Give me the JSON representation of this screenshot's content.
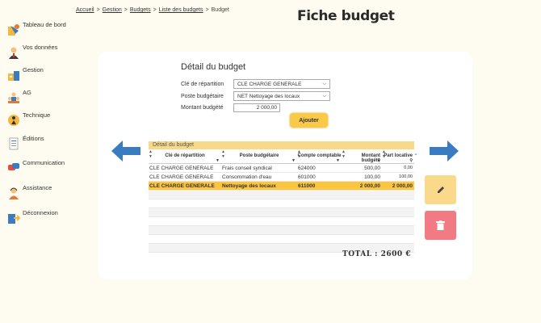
{
  "sidebar": {
    "items": [
      {
        "label": "Tableau de bord",
        "icon": "dashboard-icon"
      },
      {
        "label": "Vos données",
        "icon": "user-icon"
      },
      {
        "label": "Gestion",
        "icon": "management-icon"
      },
      {
        "label": "AG",
        "icon": "meeting-icon"
      },
      {
        "label": "Technique",
        "icon": "technique-icon"
      },
      {
        "label": "Éditions",
        "icon": "document-icon"
      },
      {
        "label": "Communication",
        "icon": "chat-icon"
      },
      {
        "label": "Assistance",
        "icon": "support-icon"
      },
      {
        "label": "Déconnexion",
        "icon": "logout-icon"
      }
    ]
  },
  "breadcrumb": {
    "items": [
      "Accueil",
      "Gestion",
      "Budgets",
      "Liste des budgets"
    ],
    "current": "Budget",
    "separator": ">"
  },
  "page_title": "Fiche budget",
  "form": {
    "title": "Détail du budget",
    "repartition_label": "Clé de répartition",
    "repartition_value": "CLE CHARGE GENERALE",
    "poste_label": "Poste budgétaire",
    "poste_value": "NET Nettoyage des locaux",
    "montant_label": "Montant budgété",
    "montant_value": "2 000,00",
    "add_label": "Ajouter"
  },
  "table": {
    "caption": "Détail du budget",
    "columns": [
      "Clé de répartition",
      "Poste budgétaire",
      "Compte comptable",
      "Montant budgété",
      "Part locative"
    ],
    "rows": [
      {
        "cle": "CLE CHARGE GENERALE",
        "poste": "Frais conseil syndical",
        "compte": "624000",
        "montant": "500,00",
        "part": "0,00"
      },
      {
        "cle": "CLE CHARGE GENERALE",
        "poste": "Consommation d'eau",
        "compte": "601000",
        "montant": "100,00",
        "part": "100,00"
      },
      {
        "cle": "CLE CHARGE GENERALE",
        "poste": "Nettoyage des locaux",
        "compte": "611000",
        "montant": "2 000,00",
        "part": "2 000,00"
      }
    ]
  },
  "total": "TOTAL : 2600 €",
  "colors": {
    "accent": "#fbc53d",
    "arrow": "#3b7bbf",
    "edit": "#fad98b",
    "delete": "#f27a82"
  }
}
